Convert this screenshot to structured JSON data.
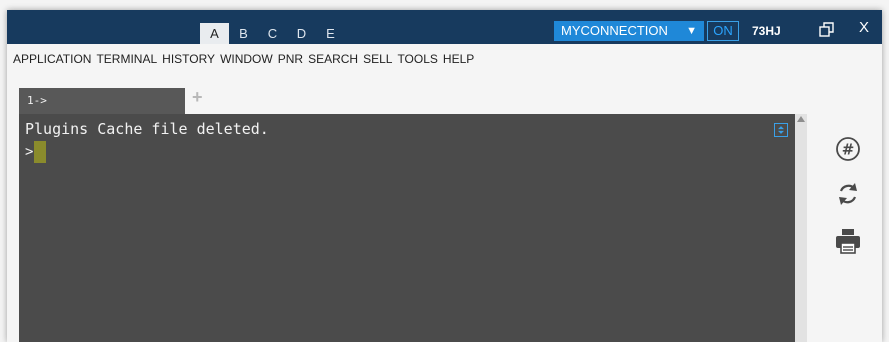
{
  "session_tabs": [
    "A",
    "B",
    "C",
    "D",
    "E"
  ],
  "active_session_tab": "A",
  "connection": {
    "name": "MYCONNECTION",
    "status": "ON",
    "user_id": "73HJ"
  },
  "window_controls": {
    "close_label": "X"
  },
  "menu": [
    "APPLICATION",
    "TERMINAL",
    "HISTORY",
    "WINDOW",
    "PNR",
    "SEARCH",
    "SELL",
    "TOOLS",
    "HELP"
  ],
  "terminal_tab": {
    "label": "1->",
    "add_label": "+"
  },
  "terminal": {
    "output": "Plugins Cache file deleted.",
    "prompt": ">"
  },
  "side_icons": [
    "hash-circle-icon",
    "refresh-icon",
    "printer-icon"
  ],
  "colors": {
    "titlebar": "#173a5e",
    "accent": "#1f88d8",
    "terminal_bg": "#4b4b4b",
    "cursor": "#8a8b2c"
  }
}
